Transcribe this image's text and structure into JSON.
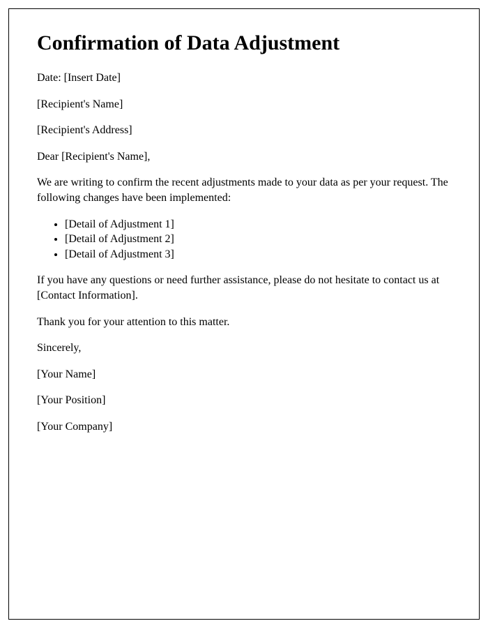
{
  "title": "Confirmation of Data Adjustment",
  "date_line": "Date: [Insert Date]",
  "recipient_name": "[Recipient's Name]",
  "recipient_address": "[Recipient's Address]",
  "salutation": "Dear [Recipient's Name],",
  "intro": "We are writing to confirm the recent adjustments made to your data as per your request. The following changes have been implemented:",
  "adjustments": [
    "[Detail of Adjustment 1]",
    "[Detail of Adjustment 2]",
    "[Detail of Adjustment 3]"
  ],
  "questions": "If you have any questions or need further assistance, please do not hesitate to contact us at [Contact Information].",
  "thank_you": "Thank you for your attention to this matter.",
  "closing": "Sincerely,",
  "sender_name": "[Your Name]",
  "sender_position": "[Your Position]",
  "sender_company": "[Your Company]"
}
